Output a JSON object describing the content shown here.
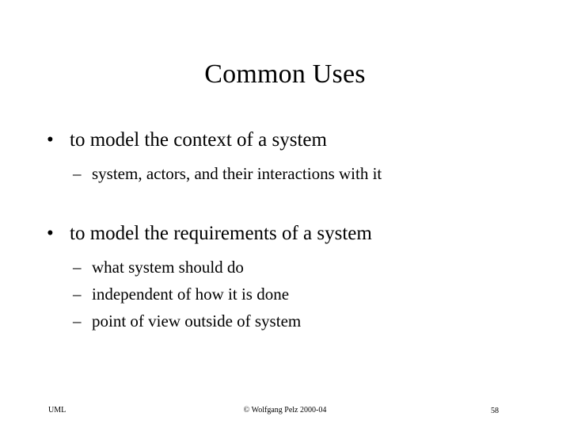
{
  "slide": {
    "title": "Common Uses",
    "background_color": "#ffffff",
    "text_color": "#000000"
  },
  "content": {
    "groups": [
      {
        "bullet_marker": "•",
        "text": "to model the context of a system",
        "sub_marker": "–",
        "sub_items": [
          {
            "text": "system, actors, and their interactions with it"
          }
        ]
      },
      {
        "bullet_marker": "•",
        "text": "to model the requirements of a system",
        "sub_marker": "–",
        "sub_items": [
          {
            "text": "what system should do"
          },
          {
            "text": "independent of how it is done"
          },
          {
            "text": "point of view outside of system"
          }
        ]
      }
    ]
  },
  "footer": {
    "left": "UML",
    "center": "© Wolfgang Pelz 2000-04",
    "page_number": "58"
  }
}
